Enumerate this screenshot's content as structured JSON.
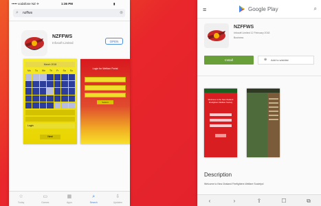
{
  "left_phone": {
    "status_bar": {
      "carrier": "••••• vodafone NZ ✈",
      "time": "1:36 PM",
      "battery": "▮"
    },
    "search": {
      "icon": "search-icon",
      "query": "nzffws",
      "clear_icon": "clear-icon"
    },
    "app": {
      "name": "NZFFWS",
      "developer": "Infosoft Limited",
      "action_label": "OPEN"
    },
    "screenshot1": {
      "header": "March 2018",
      "days": [
        "Mo",
        "Tu",
        "We",
        "Th",
        "Fr",
        "Sa",
        "Su"
      ],
      "login_label": "Login",
      "button": "Next"
    },
    "screenshot2": {
      "title": "Login for Welfare Portal",
      "button": "Submit"
    },
    "tabbar": [
      {
        "icon": "star-icon",
        "label": "Today"
      },
      {
        "icon": "games-icon",
        "label": "Games"
      },
      {
        "icon": "apps-icon",
        "label": "Apps"
      },
      {
        "icon": "search-icon",
        "label": "Search",
        "active": true
      },
      {
        "icon": "updates-icon",
        "label": "Updates"
      }
    ]
  },
  "right_phone": {
    "header": {
      "menu_icon": "menu-icon",
      "brand": "Google Play",
      "search_icon": "search-icon"
    },
    "app": {
      "name": "NZFFWS",
      "developer_line": "Infosoft Limited   12 February 2018",
      "category": "Business",
      "install_label": "Install",
      "wishlist_label": "Add to wishlist"
    },
    "screenshot1": {
      "title": "Welcome to the New Zealand Firefighters Welfare Society"
    },
    "description": {
      "title": "Description",
      "text": "Welcome to New Zealand Firefighters Welfare Societys!"
    },
    "navbar": [
      "‹",
      "›",
      "⇪",
      "☐",
      "⧉"
    ]
  }
}
